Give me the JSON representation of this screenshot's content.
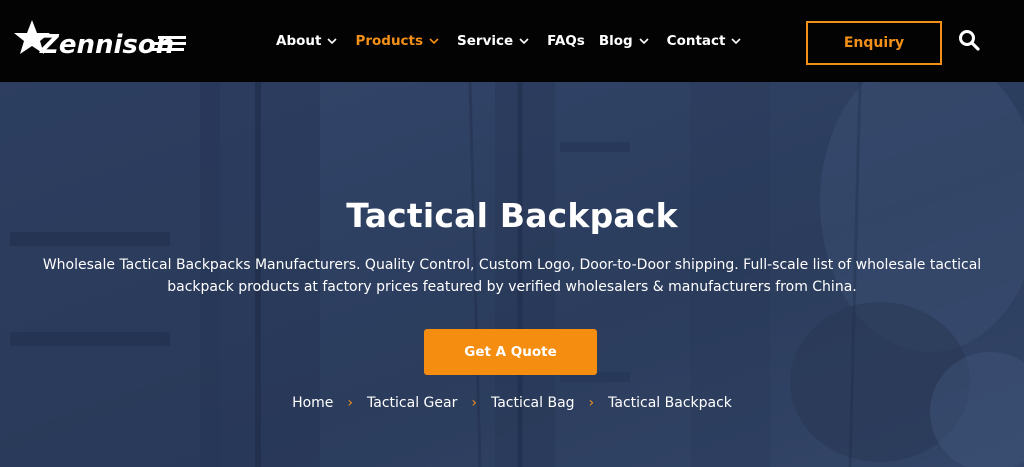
{
  "brand": {
    "name": "Zennison"
  },
  "nav": {
    "items": [
      {
        "label": "About",
        "has_dropdown": true,
        "active": false
      },
      {
        "label": "Products",
        "has_dropdown": true,
        "active": true
      },
      {
        "label": "Service",
        "has_dropdown": true,
        "active": false
      },
      {
        "label": "FAQs",
        "has_dropdown": false,
        "active": false
      },
      {
        "label": "Blog",
        "has_dropdown": true,
        "active": false
      },
      {
        "label": "Contact",
        "has_dropdown": true,
        "active": false
      }
    ],
    "enquiry_label": "Enquiry",
    "search_icon": "search-icon"
  },
  "hero": {
    "title": "Tactical Backpack",
    "description_line1": "Wholesale Tactical Backpacks Manufacturers. Quality Control, Custom Logo, Door-to-Door shipping. Full-scale list of wholesale tactical",
    "description_line2": "backpack products at factory prices featured by verified wholesalers & manufacturers from China.",
    "cta_label": "Get A Quote"
  },
  "breadcrumb": {
    "items": [
      "Home",
      "Tactical Gear",
      "Tactical Bag",
      "Tactical Backpack"
    ],
    "separator": "›"
  },
  "colors": {
    "accent": "#f39019",
    "header_bg": "#030303",
    "hero_overlay": "#34486c",
    "text": "#ffffff"
  }
}
